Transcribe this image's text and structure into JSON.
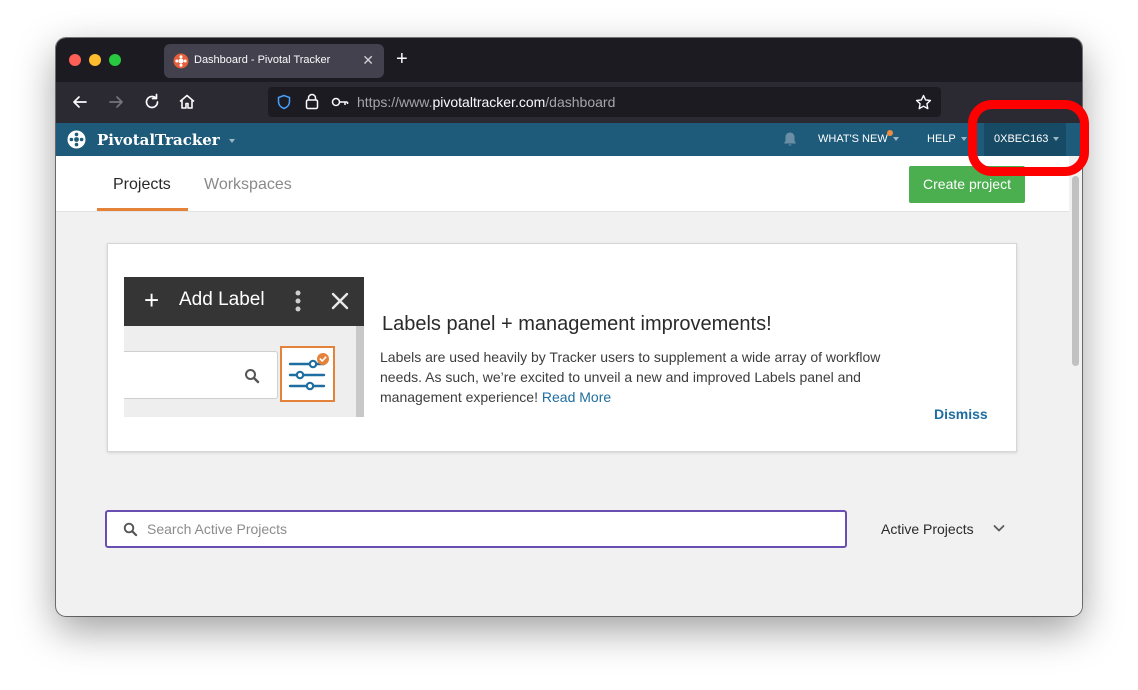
{
  "browser": {
    "tab_title": "Dashboard - Pivotal Tracker",
    "url_scheme": "https://www.",
    "url_host": "pivotaltracker.com",
    "url_path": "/dashboard"
  },
  "header": {
    "logo": "PivotalTracker",
    "whats_new": "WHAT'S NEW",
    "help": "HELP",
    "user": "0XBEC163"
  },
  "subnav": {
    "tabs": [
      {
        "label": "Projects",
        "active": true
      },
      {
        "label": "Workspaces",
        "active": false
      }
    ],
    "create_button": "Create project"
  },
  "banner": {
    "image": {
      "add_label": "Add Label"
    },
    "title": "Labels panel + management improvements!",
    "body": "Labels are used heavily by Tracker users to supplement a wide array of workflow needs. As such, we’re excited to unveil a new and improved Labels panel and management experience!",
    "read_more": "Read More",
    "dismiss": "Dismiss"
  },
  "search": {
    "placeholder": "Search Active Projects"
  },
  "filter": {
    "selected": "Active Projects"
  },
  "colors": {
    "header_bg": "#1e5a79",
    "accent_orange": "#e4823a",
    "create_green": "#4bae4f",
    "link_blue": "#1e6ea1",
    "search_border": "#6a4fb2",
    "highlight_red": "#ff0000"
  }
}
